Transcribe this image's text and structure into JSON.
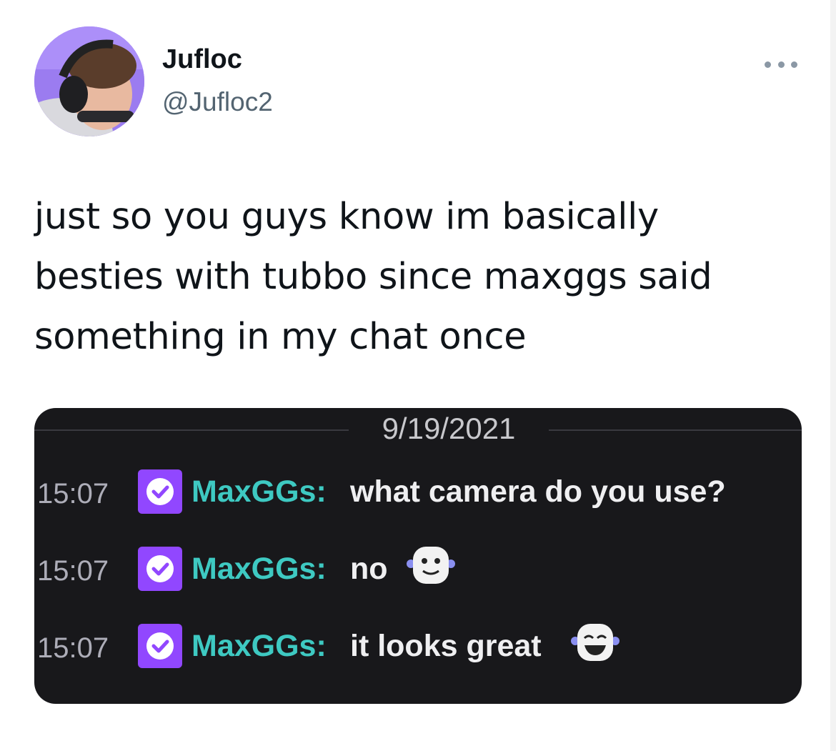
{
  "tweet": {
    "display_name": "Jufloc",
    "handle": "@Jufloc2",
    "text": "just so you guys know im basically\nbesties with tubbo since maxggs said\nsomething in my chat once",
    "more_icon": "more-horizontal-icon"
  },
  "chat": {
    "date": "9/19/2021",
    "messages": [
      {
        "time": "15:07",
        "user": "MaxGGs:",
        "text": "what camera do you use?",
        "emote": ""
      },
      {
        "time": "15:07",
        "user": "MaxGGs:",
        "text": "no",
        "emote": "smiling-face-emote"
      },
      {
        "time": "15:07",
        "user": "MaxGGs:",
        "text": "it looks great",
        "emote": "grinning-face-emote"
      }
    ],
    "badge_icon": "verified-check-badge-icon"
  },
  "colors": {
    "chat_background": "#18181b",
    "username": "#3ec9c2",
    "badge": "#9147ff",
    "handle": "#536471"
  }
}
